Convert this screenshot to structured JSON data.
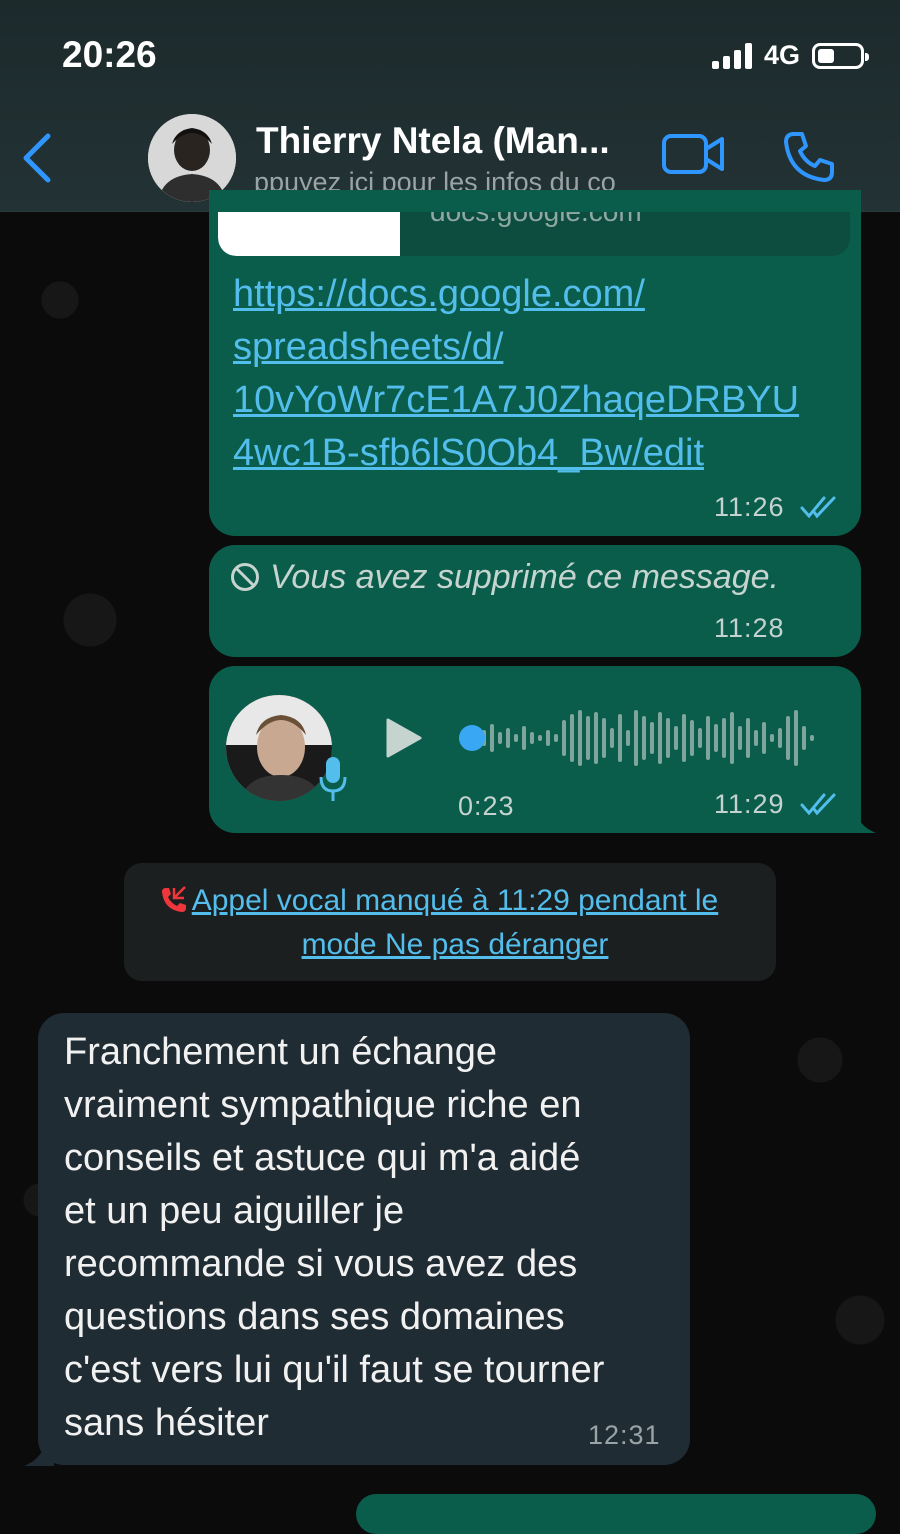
{
  "status_bar": {
    "time": "20:26",
    "network": "4G"
  },
  "header": {
    "contact_name": "Thierry Ntela (Man...",
    "subtitle": "ppuyez ici pour les infos du co"
  },
  "messages": {
    "link_message": {
      "preview_domain": "docs.google.com",
      "url": "https://docs.google.com/spreadsheets/d/10vYoWr7cE1A7J0ZhaqeDRBYU4wc1B-sfb6lS0Ob4_Bw/edit",
      "lines": [
        "https://docs.google.com/",
        "spreadsheets/d/",
        "10vYoWr7cE1A7J0ZhaqeDRBYU",
        "4wc1B-sfb6lS0Ob4_Bw/edit"
      ],
      "time": "11:26"
    },
    "deleted_message": {
      "text": "Vous avez supprimé ce message.",
      "time": "11:28"
    },
    "voice_message": {
      "duration": "0:23",
      "time": "11:29"
    },
    "missed_call": {
      "text": "Appel vocal manqué à 11:29 pendant le mode Ne pas déranger"
    },
    "incoming_message": {
      "lines": [
        "Franchement un échange",
        "vraiment sympathique riche en",
        "conseils et astuce qui m'a aidé",
        "et un peu aiguiller je",
        "recommande si vous avez des",
        "questions dans ses domaines",
        "c'est vers lui qu'il faut se tourner",
        "sans hésiter"
      ],
      "time": "12:31"
    }
  },
  "colors": {
    "accent": "#53bdeb",
    "outgoing_bubble": "#0a5c4b",
    "incoming_bubble": "#202c33",
    "header_icon": "#2f95ff",
    "missed_call_red": "#f0363a"
  },
  "icons": {
    "back": "chevron-left-icon",
    "video": "video-camera-icon",
    "call": "phone-icon",
    "read": "double-check-icon",
    "deleted": "ban-icon",
    "play": "play-icon",
    "mic": "microphone-icon",
    "missed_call": "missed-call-icon"
  }
}
